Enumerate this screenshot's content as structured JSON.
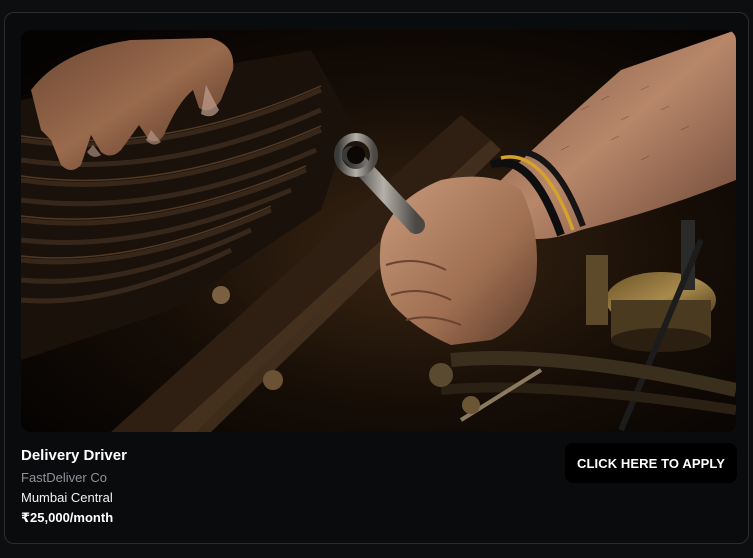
{
  "job": {
    "title": "Delivery Driver",
    "company": "FastDeliver Co",
    "location": "Mumbai Central",
    "salary": "₹25,000/month"
  },
  "apply_button": {
    "label": "CLICK HERE TO APPLY"
  },
  "image": {
    "subject": "mechanic-hands-with-wrench-over-engine"
  },
  "colors": {
    "page_bg": "#0d0e10",
    "card_bg": "#0a0b0d",
    "card_border": "#2a2c31",
    "button_bg": "#000000",
    "muted_text": "#8f939a"
  }
}
